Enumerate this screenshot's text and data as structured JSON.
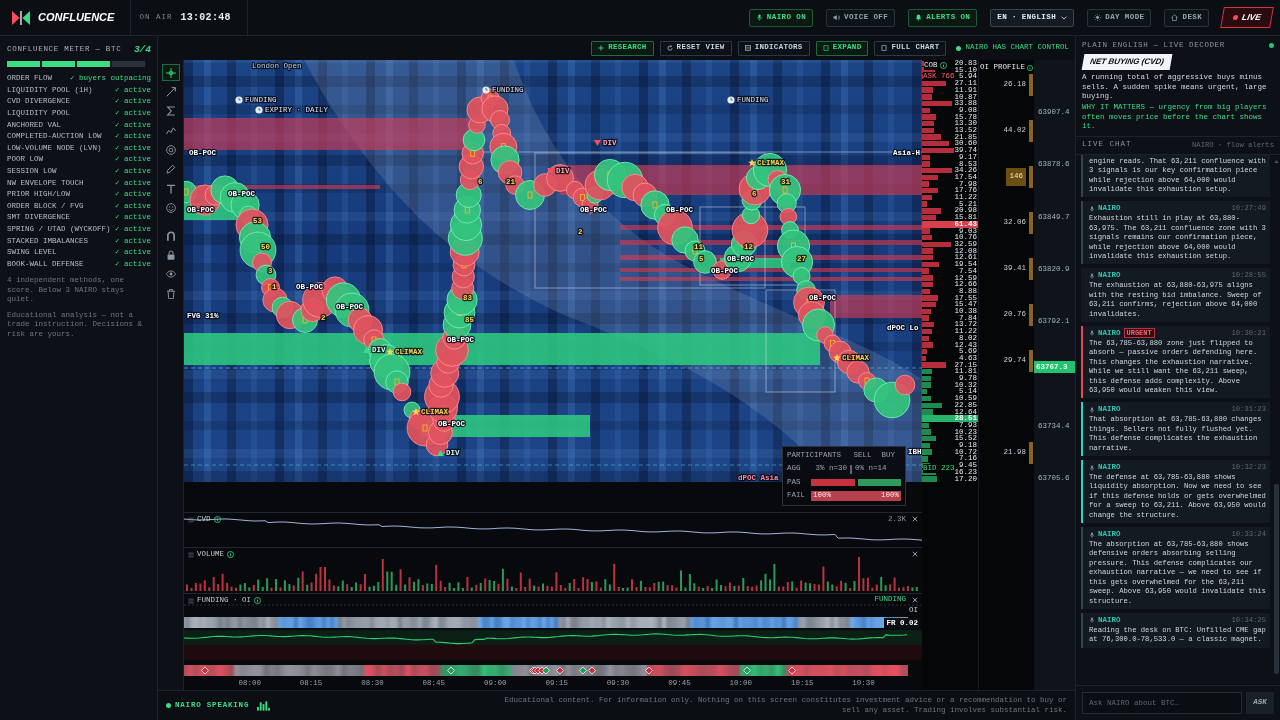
{
  "topbar": {
    "brand": "CONFLUENCE",
    "on_air": "ON AIR",
    "clock": "13:02:48",
    "toggles": [
      {
        "label": "NAIRO ON",
        "on": true
      },
      {
        "label": "VOICE OFF",
        "on": false
      },
      {
        "label": "ALERTS ON",
        "on": true
      }
    ],
    "language": "EN · ENGLISH",
    "buttons": [
      "DAY MODE",
      "DESK"
    ],
    "live": "LIVE"
  },
  "confluence_meter": {
    "title": "CONFLUENCE METER — BTC",
    "score": "3/4",
    "level": 0.75,
    "rows": [
      {
        "name": "ORDER FLOW",
        "status": "✓ buyers outpacing"
      },
      {
        "name": "LIQUIDITY POOL (1H)",
        "status": "✓ active"
      },
      {
        "name": "CVD DIVERGENCE",
        "status": "✓ active"
      },
      {
        "name": "LIQUIDITY POOL",
        "status": "✓ active"
      },
      {
        "name": "ANCHORED VAL",
        "status": "✓ active"
      },
      {
        "name": "COMPLETED-AUCTION LOW",
        "status": "✓ active"
      },
      {
        "name": "LOW-VOLUME NODE (LVN)",
        "status": "✓ active"
      },
      {
        "name": "POOR LOW",
        "status": "✓ active"
      },
      {
        "name": "SESSION LOW",
        "status": "✓ active"
      },
      {
        "name": "NW ENVELOPE TOUCH",
        "status": "✓ active"
      },
      {
        "name": "PRIOR HIGH/LOW",
        "status": "✓ active"
      },
      {
        "name": "ORDER BLOCK / FVG",
        "status": "✓ active"
      },
      {
        "name": "SMT DIVERGENCE",
        "status": "✓ active"
      },
      {
        "name": "SPRING / UTAD (WYCKOFF)",
        "status": "✓ active"
      },
      {
        "name": "STACKED IMBALANCES",
        "status": "✓ active"
      },
      {
        "name": "SWING LEVEL",
        "status": "✓ active"
      },
      {
        "name": "BOOK-WALL DEFENSE",
        "status": "✓ active"
      }
    ],
    "notes": [
      "4 independent methods, one score. Below 3 NAIRO stays quiet.",
      "Educational analysis — not a trade instruction. Decisions & risk are yours."
    ]
  },
  "chart_toolbar": {
    "buttons": [
      {
        "label": "RESEARCH",
        "active": true
      },
      {
        "label": "RESET VIEW",
        "active": false
      },
      {
        "label": "INDICATORS",
        "active": false
      },
      {
        "label": "EXPAND",
        "active": true
      },
      {
        "label": "FULL CHART",
        "active": false
      }
    ],
    "control_status": "NAIRO HAS CHART CONTROL"
  },
  "drawing_tools": [
    {
      "selected": true
    },
    {
      "selected": false
    },
    {
      "selected": false
    },
    {
      "selected": false
    },
    {
      "selected": false
    },
    {
      "selected": false
    },
    {
      "selected": false
    },
    {
      "selected": false
    },
    {
      "selected": false
    },
    {
      "selected": false
    },
    {
      "selected": false
    },
    {
      "selected": false
    }
  ],
  "heatmap": {
    "labels": [
      {
        "text": "London Open",
        "kind": "session"
      },
      {
        "text": "FUNDING",
        "kind": "event"
      },
      {
        "text": "FUNDING",
        "kind": "event"
      },
      {
        "text": "FUNDING",
        "kind": "event"
      },
      {
        "text": "EXPIRY · DAILY",
        "kind": "event"
      },
      {
        "text": "DIV",
        "kind": "bearish"
      },
      {
        "text": "OB-POC",
        "kind": "level"
      },
      {
        "text": "Asia-H",
        "kind": "zone"
      },
      {
        "text": "CLIMAX",
        "kind": "signal"
      },
      {
        "text": "DIV",
        "kind": "bearish"
      },
      {
        "text": "6",
        "kind": "count"
      },
      {
        "text": "21",
        "kind": "count"
      },
      {
        "text": "31",
        "kind": "count"
      },
      {
        "text": "OB-POC",
        "kind": "level"
      },
      {
        "text": "6",
        "kind": "count"
      },
      {
        "text": "OB-POC",
        "kind": "level"
      },
      {
        "text": "OB-POC",
        "kind": "level"
      },
      {
        "text": "OB-POC",
        "kind": "level"
      },
      {
        "text": "53",
        "kind": "count"
      },
      {
        "text": "2",
        "kind": "count"
      },
      {
        "text": "50",
        "kind": "count"
      },
      {
        "text": "11",
        "kind": "count"
      },
      {
        "text": "12",
        "kind": "count"
      },
      {
        "text": "5",
        "kind": "count"
      },
      {
        "text": "OB-POC",
        "kind": "level"
      },
      {
        "text": "27",
        "kind": "count"
      },
      {
        "text": "3",
        "kind": "count"
      },
      {
        "text": "OB-POC",
        "kind": "level"
      },
      {
        "text": "1",
        "kind": "count"
      },
      {
        "text": "OB-POC",
        "kind": "level"
      },
      {
        "text": "83",
        "kind": "count"
      },
      {
        "text": "OB-POC",
        "kind": "level"
      },
      {
        "text": "OB-POC",
        "kind": "level"
      },
      {
        "text": "FVG 31%",
        "kind": "zone"
      },
      {
        "text": "2",
        "kind": "count"
      },
      {
        "text": "85",
        "kind": "count"
      },
      {
        "text": "dPOC Lo",
        "kind": "zone"
      },
      {
        "text": "OB-POC",
        "kind": "level"
      },
      {
        "text": "DIV",
        "kind": "bullish"
      },
      {
        "text": "CLIMAX",
        "kind": "signal"
      },
      {
        "text": "CLIMAX",
        "kind": "signal"
      },
      {
        "text": "CLIMAX",
        "kind": "signal"
      },
      {
        "text": "OB-POC",
        "kind": "level"
      },
      {
        "text": "DIV",
        "kind": "bullish"
      },
      {
        "text": "IBH",
        "kind": "zone"
      },
      {
        "text": "dPOC Asia",
        "kind": "anchor"
      }
    ]
  },
  "order_book": {
    "title": "COB",
    "ask_total": "ASK 766",
    "bid_total": "BID 223",
    "asks": [
      "20.83",
      "15.10",
      "5.94",
      "27.11",
      "11.91",
      "10.87",
      "33.88",
      "9.08",
      "15.78",
      "13.30",
      "13.52",
      "21.85",
      "30.60",
      "39.74",
      "9.17",
      "8.53",
      "34.26",
      "17.54",
      "7.98",
      "17.76",
      "11.22",
      "5.21",
      "20.98",
      "15.81",
      "61.43",
      "9.03",
      "10.76",
      "32.59",
      "12.08",
      "12.61",
      "19.54",
      "7.54",
      "12.59",
      "12.66",
      "8.88",
      "17.55",
      "15.47",
      "10.38",
      "7.84",
      "13.72",
      "11.22",
      "8.02",
      "12.43",
      "5.69",
      "4.63",
      "27.15"
    ],
    "bids": [
      "11.81",
      "9.78",
      "10.32",
      "5.14",
      "10.59",
      "22.85",
      "12.64",
      "28.51",
      "7.93",
      "10.23",
      "15.52",
      "9.18",
      "10.72",
      "7.16",
      "9.45",
      "16.23",
      "17.20"
    ]
  },
  "oi_profile": {
    "title": "OI PROFILE",
    "values": [
      "26.18",
      "44.02",
      "146",
      "32.06",
      "39.41",
      "20.76",
      "29.74",
      "21.98"
    ]
  },
  "price_axis": {
    "ticks": [
      "63907.4",
      "63878.6",
      "63849.7",
      "63820.9",
      "63792.1",
      "63734.4",
      "63705.6"
    ],
    "current": "63767.3"
  },
  "participants": {
    "title": "PARTICIPANTS",
    "columns": [
      "SELL",
      "BUY"
    ],
    "rows": [
      {
        "label": "AGG",
        "kind": "text",
        "sell": "3% n=30",
        "buy": "0% n=14"
      },
      {
        "label": "PAS",
        "kind": "split"
      },
      {
        "label": "FAIL",
        "kind": "full",
        "sell": "100%",
        "buy": "100%"
      }
    ]
  },
  "panes": [
    {
      "title": "CVD",
      "kind": "line",
      "scale": "2.3K"
    },
    {
      "title": "VOLUME",
      "kind": "bars"
    },
    {
      "title": "FUNDING · OI",
      "kind": "funding",
      "tag": "FUNDING",
      "axis_label": "OI",
      "rate": "FR 0.02"
    }
  ],
  "time_axis": [
    "08:00",
    "08:15",
    "08:30",
    "08:45",
    "09:00",
    "09:15",
    "09:30",
    "09:45",
    "10:00",
    "10:15",
    "10:30"
  ],
  "status_bar": {
    "speaking": "NAIRO SPEAKING",
    "disclaimer": "Educational content. For information only. Nothing on this screen constitutes investment advice or a recommendation to buy or sell any asset. Trading involves substantial risk."
  },
  "decoder": {
    "title": "PLAIN ENGLISH — LIVE DECODER",
    "term": "NET BUYING (CVD)",
    "explanation": "A running total of aggressive buys minus sells. A sudden spike means urgent, large buying.",
    "why": "WHY IT MATTERS — urgency from big players often moves price before the chart shows it."
  },
  "chat": {
    "title": "LIVE CHAT",
    "subtitle": "NAIRO · flow alerts",
    "messages": [
      {
        "text": "engine reads. That 63,211 confluence with 3 signals is our key confirmation piece while rejection above 64,000 would invalidate this exhaustion setup.",
        "kind": "normal"
      },
      {
        "author": "NAIRO",
        "time": "10:27:49",
        "text": "Exhaustion still in play at 63,880-63,975. The 63,211 confluence zone with 3 signals remains our confirmation piece, while rejection above 64,000 would invalidate this exhaustion setup.",
        "kind": "normal"
      },
      {
        "author": "NAIRO",
        "time": "10:28:55",
        "text": "The exhaustion at 63,880-63,975 aligns with the resting bid imbalance. Sweep of 63,211 confirms, rejection above 64,000 invalidates.",
        "kind": "plain"
      },
      {
        "author": "NAIRO",
        "badge": "URGENT",
        "time": "10:30:21",
        "text": "The 63,785-63,880 zone just flipped to absorb — passive orders defending here. This changes the exhaustion narrative. While we still want the 63,211 sweep, this defense adds complexity. Above 63,950 would weaken this view.",
        "kind": "urgent"
      },
      {
        "author": "NAIRO",
        "time": "10:31:23",
        "text": "That absorption at 63,785-63,880 changes things. Sellers not fully flushed yet. This defense complicates the exhaustion narrative.",
        "kind": "update"
      },
      {
        "author": "NAIRO",
        "time": "10:32:23",
        "text": "The defense at 63,785-63,880 shows liquidity absorption. Now we need to see if this defense holds or gets overwhelmed for a sweep to 63,211. Above 63,950 would change the structure.",
        "kind": "update"
      },
      {
        "author": "NAIRO",
        "time": "10:33:24",
        "text": "The absorption at 63,785-63,880 shows defensive orders absorbing selling pressure. This defense complicates our exhaustion narrative — we need to see if this gets overwhelmed for the 63,211 sweep. Above 63,950 would invalidate this structure.",
        "kind": "normal"
      },
      {
        "author": "NAIRO",
        "time": "10:34:25",
        "text": "Reading the desk on BTC: Unfilled CME gap at 76,300.0-78,533.0 — a classic magnet.",
        "kind": "normal"
      }
    ],
    "input": {
      "placeholder": "Ask NAIRO about BTC…"
    },
    "send": "ASK"
  }
}
